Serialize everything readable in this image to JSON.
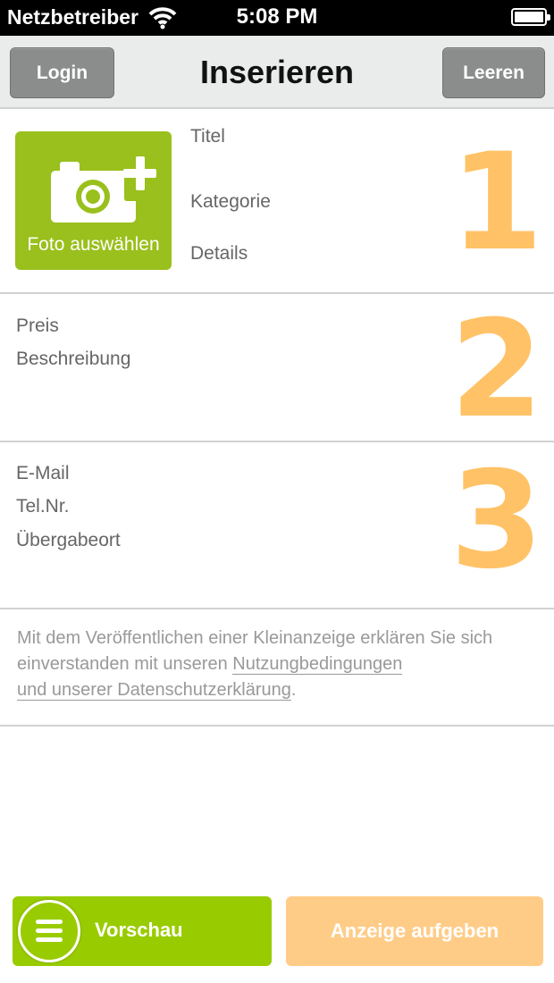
{
  "status_bar": {
    "carrier": "Netzbetreiber",
    "time": "5:08 PM",
    "icons": [
      "wifi-icon",
      "battery-icon"
    ]
  },
  "nav": {
    "title": "Inserieren",
    "left_button": "Login",
    "right_button": "Leeren"
  },
  "section1": {
    "number": "1",
    "photo_button": "Foto auswählen",
    "photo_icon": "camera-plus-icon",
    "fields": [
      "Titel",
      "Kategorie",
      "Details"
    ]
  },
  "section2": {
    "number": "2",
    "fields": [
      "Preis",
      "Beschreibung"
    ]
  },
  "section3": {
    "number": "3",
    "fields": [
      "E-Mail",
      "Tel.Nr.",
      "Übergabeort"
    ]
  },
  "legal": {
    "text_before": "Mit dem Veröffentlichen einer Kleinanzeige erklären Sie sich einverstanden mit unseren ",
    "link1": "Nutzungbedingungen",
    "link2": "und unserer Datenschutzerklärung",
    "text_after": "."
  },
  "bottom": {
    "preview_label": "Vorschau",
    "preview_icon": "menu-icon",
    "publish_label": "Anzeige aufgeben"
  },
  "colors": {
    "green": "#99cc00",
    "photo_green": "#99c01c",
    "orange_number": "#ffc266",
    "publish_disabled": "#ffcc88",
    "nav_button": "#8a8d8c"
  }
}
